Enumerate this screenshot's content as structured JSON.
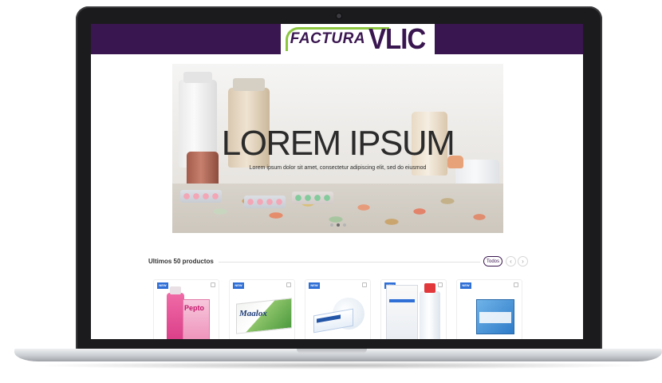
{
  "header": {
    "logo_part1": "FACTURA",
    "logo_part2": "VLIC",
    "brand_color": "#3a1650",
    "accent_color": "#8cc63f"
  },
  "hero": {
    "title": "LOREM IPSUM",
    "subtitle": "Lorem ipsum dolor sit amet, consectetur adipiscing elit, sed do eiusmod",
    "slides": 3,
    "active_slide": 1
  },
  "products": {
    "section_title": "Ultimos 50 productos",
    "view_all_label": "Todos",
    "prev_icon": "chevron-left-icon",
    "next_icon": "chevron-right-icon",
    "items": [
      {
        "badge": "NEW",
        "name": "Pepto"
      },
      {
        "badge": "NEW",
        "name": "Maalox"
      },
      {
        "badge": "NEW",
        "name": ""
      },
      {
        "badge": "NEW",
        "name": ""
      },
      {
        "badge": "NEW",
        "name": ""
      }
    ]
  }
}
